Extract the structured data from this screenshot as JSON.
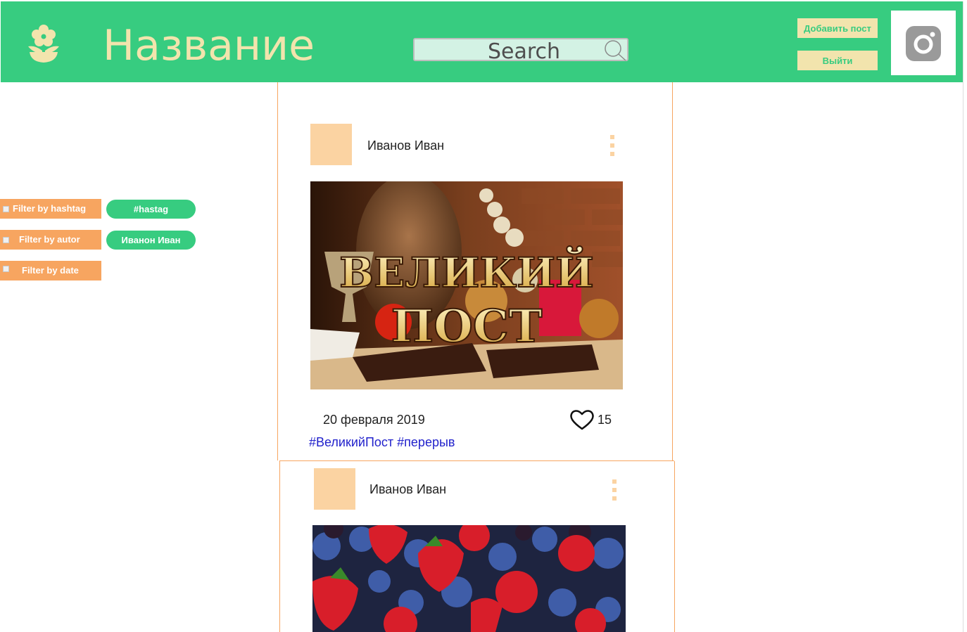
{
  "header": {
    "logo_icon": "flower-pot-icon",
    "title": "Название",
    "search_placeholder": "Search",
    "add_post_label": "Добавить пост",
    "logout_label": "Выйти",
    "instagram_icon": "instagram-icon"
  },
  "filters": [
    {
      "label": "Filter by hashtag",
      "chip": "#hastag"
    },
    {
      "label": "Filter by autor",
      "chip": "Иванон Иван"
    },
    {
      "label": "Filter by date"
    }
  ],
  "posts": [
    {
      "author": "Иванов Иван",
      "image_text_line1": "ВЕЛИКИЙ",
      "image_text_line2": "ПОСТ",
      "date": "20 февраля 2019",
      "likes": "15",
      "tags": "#ВеликийПост #перерыв"
    },
    {
      "author": "Иванов Иван"
    }
  ],
  "colors": {
    "header_green": "#37cc80",
    "cream": "#f2e4ad",
    "orange": "#f7a560",
    "avatar_peach": "#fbd3a2",
    "hashtag_blue": "#2222cc"
  }
}
